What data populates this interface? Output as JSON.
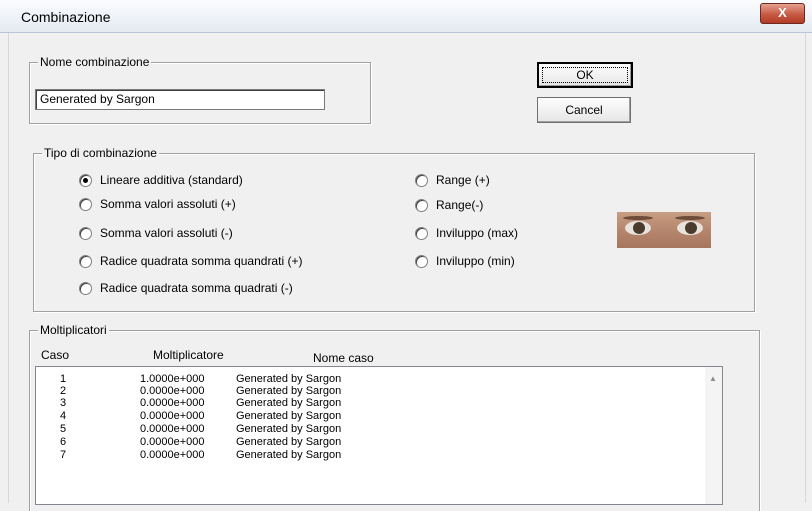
{
  "window": {
    "title": "Combinazione",
    "close_label": "X"
  },
  "name_group": {
    "legend": "Nome combinazione",
    "value": "Generated by Sargon"
  },
  "buttons": {
    "ok_label": "OK",
    "cancel_label": "Cancel"
  },
  "type_group": {
    "legend": "Tipo di combinazione",
    "options": [
      {
        "label": "Lineare additiva (standard)",
        "selected": true
      },
      {
        "label": "Somma valori assoluti (+)",
        "selected": false
      },
      {
        "label": "Somma valori assoluti (-)",
        "selected": false
      },
      {
        "label": "Radice quadrata somma quandrati (+)",
        "selected": false
      },
      {
        "label": "Radice quadrata somma quadrati (-)",
        "selected": false
      },
      {
        "label": "Range (+)",
        "selected": false
      },
      {
        "label": "Range(-)",
        "selected": false
      },
      {
        "label": "Inviluppo (max)",
        "selected": false
      },
      {
        "label": "Inviluppo (min)",
        "selected": false
      }
    ]
  },
  "multipliers": {
    "legend": "Moltiplicatori",
    "columns": [
      "Caso",
      "Moltiplicatore",
      "Nome caso"
    ],
    "rows": [
      [
        "1",
        "1.0000e+000",
        "Generated by Sargon"
      ],
      [
        "2",
        "0.0000e+000",
        "Generated by Sargon"
      ],
      [
        "3",
        "0.0000e+000",
        "Generated by Sargon"
      ],
      [
        "4",
        "0.0000e+000",
        "Generated by Sargon"
      ],
      [
        "5",
        "0.0000e+000",
        "Generated by Sargon"
      ],
      [
        "6",
        "0.0000e+000",
        "Generated by Sargon"
      ],
      [
        "7",
        "0.0000e+000",
        "Generated by Sargon"
      ]
    ]
  }
}
